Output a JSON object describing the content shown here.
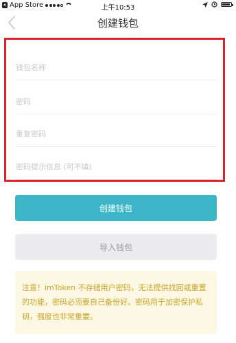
{
  "status_bar": {
    "carrier": "App Store",
    "time": "上午10:53"
  },
  "navbar": {
    "back_glyph": "<",
    "title": "创建钱包"
  },
  "form": {
    "wallet_name_placeholder": "钱包名称",
    "password_placeholder": "密码",
    "repeat_password_placeholder": "重复密码",
    "hint_placeholder": "密码提示信息 (可不填)"
  },
  "buttons": {
    "create_label": "创建钱包",
    "import_label": "导入钱包"
  },
  "notice": {
    "text": "注意！imToken 不存储用户密码，无法提供找回或重置的功能，密码必须要自己备份好。密码用于加密保护私钥，强度也非常重要。"
  },
  "colors": {
    "primary_button": "#3cb6c7",
    "secondary_button": "#ebebf0",
    "highlight_border": "#d8242c",
    "notice_background": "#fdf8e4",
    "notice_text": "#c9a52a"
  }
}
